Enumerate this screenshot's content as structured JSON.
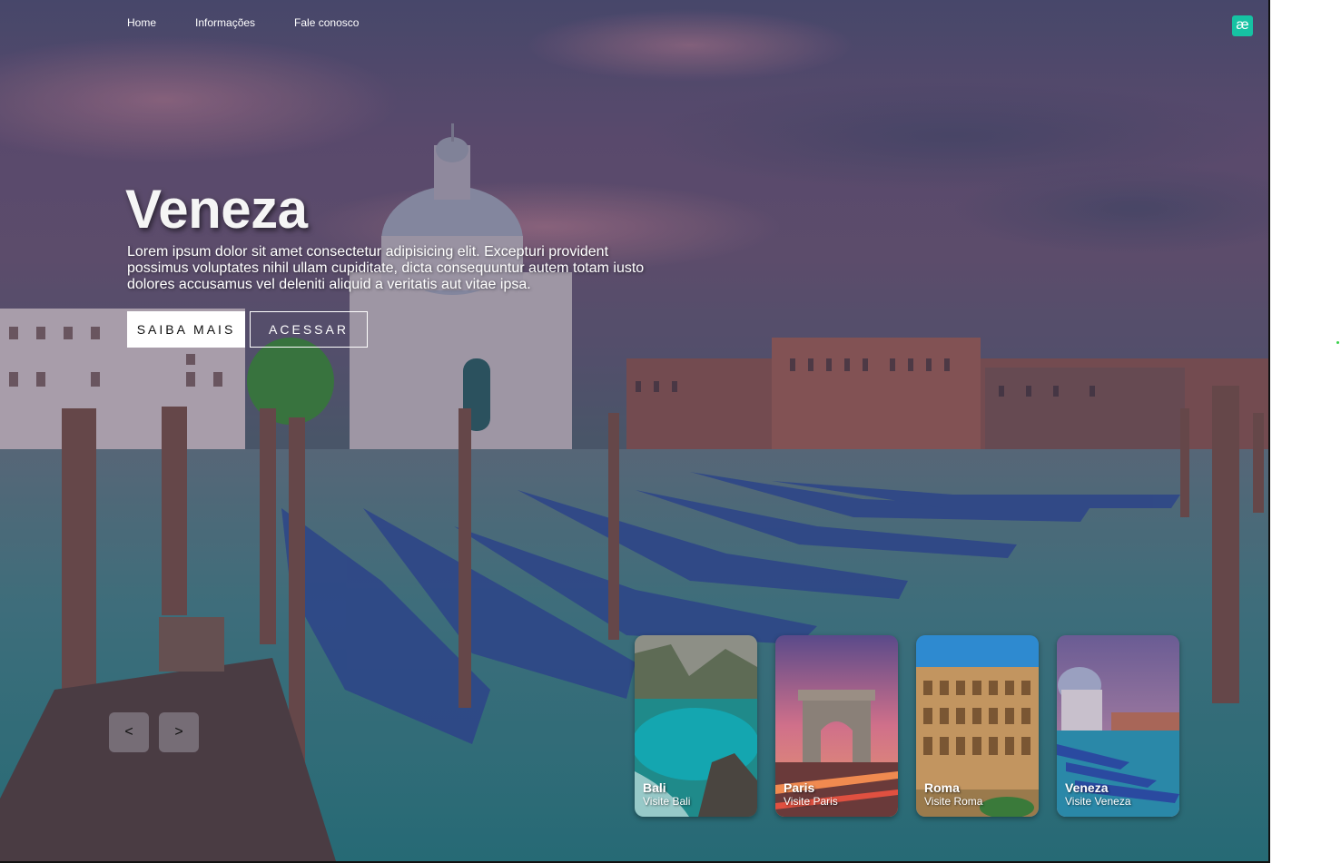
{
  "nav": {
    "items": [
      {
        "label": "Home"
      },
      {
        "label": "Informações"
      },
      {
        "label": "Fale conosco"
      }
    ],
    "logo_glyph": "æ"
  },
  "hero": {
    "title": "Veneza",
    "description": "Lorem ipsum dolor sit amet consectetur adipisicing elit. Excepturi provident possimus voluptates nihil ullam cupiditate, dicta consequuntur autem totam iusto dolores accusamus vel deleniti aliquid a veritatis aut vitae ipsa.",
    "primary_button": "SAIBA MAIS",
    "secondary_button": "ACESSAR"
  },
  "slider": {
    "prev": "<",
    "next": ">"
  },
  "cards": [
    {
      "title": "Bali",
      "subtitle": "Visite Bali"
    },
    {
      "title": "Paris",
      "subtitle": "Visite Paris"
    },
    {
      "title": "Roma",
      "subtitle": "Visite Roma"
    },
    {
      "title": "Veneza",
      "subtitle": "Visite Veneza"
    }
  ],
  "colors": {
    "logo": "#16c2a3",
    "accent_button_bg": "#ffffff",
    "water": "#2a6a74"
  }
}
